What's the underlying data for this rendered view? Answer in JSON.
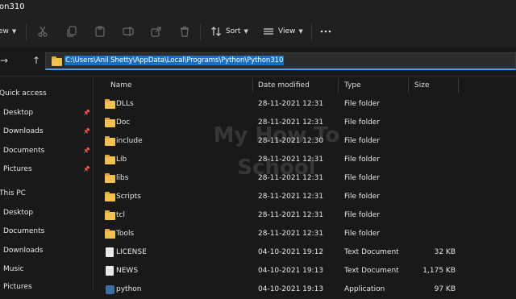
{
  "window": {
    "title": "on310"
  },
  "toolbar": {
    "view_partial": "ew",
    "sort": "Sort",
    "view": "View",
    "icons": [
      "cut-icon",
      "copy-icon",
      "paste-icon",
      "rename-icon",
      "share-icon",
      "delete-icon",
      "more-icon"
    ]
  },
  "address": {
    "back": "←",
    "forward": "→",
    "up": "↑",
    "path": "C:\\Users\\Anil Shetty\\AppData\\Local\\Programs\\Python\\Python310"
  },
  "sidebar": {
    "quick_access": "Quick access",
    "this_pc": "This PC",
    "quick_items": [
      {
        "label": "Desktop"
      },
      {
        "label": "Downloads"
      },
      {
        "label": "Documents"
      },
      {
        "label": "Pictures"
      }
    ],
    "pc_items": [
      {
        "label": "Desktop"
      },
      {
        "label": "Documents"
      },
      {
        "label": "Downloads"
      },
      {
        "label": "Music"
      },
      {
        "label": "Pictures"
      }
    ]
  },
  "columns": {
    "name": "Name",
    "date": "Date modified",
    "type": "Type",
    "size": "Size"
  },
  "files": [
    {
      "name": "DLLs",
      "date": "28-11-2021 12:31",
      "type": "File folder",
      "size": "",
      "icon": "folder"
    },
    {
      "name": "Doc",
      "date": "28-11-2021 12:31",
      "type": "File folder",
      "size": "",
      "icon": "folder"
    },
    {
      "name": "include",
      "date": "28-11-2021 12:30",
      "type": "File folder",
      "size": "",
      "icon": "folder"
    },
    {
      "name": "Lib",
      "date": "28-11-2021 12:31",
      "type": "File folder",
      "size": "",
      "icon": "folder"
    },
    {
      "name": "libs",
      "date": "28-11-2021 12:31",
      "type": "File folder",
      "size": "",
      "icon": "folder"
    },
    {
      "name": "Scripts",
      "date": "28-11-2021 12:31",
      "type": "File folder",
      "size": "",
      "icon": "folder"
    },
    {
      "name": "tcl",
      "date": "28-11-2021 12:31",
      "type": "File folder",
      "size": "",
      "icon": "folder"
    },
    {
      "name": "Tools",
      "date": "28-11-2021 12:31",
      "type": "File folder",
      "size": "",
      "icon": "folder"
    },
    {
      "name": "LICENSE",
      "date": "04-10-2021 19:12",
      "type": "Text Document",
      "size": "32 KB",
      "icon": "file"
    },
    {
      "name": "NEWS",
      "date": "04-10-2021 19:13",
      "type": "Text Document",
      "size": "1,175 KB",
      "icon": "file"
    },
    {
      "name": "python",
      "date": "04-10-2021 19:13",
      "type": "Application",
      "size": "97 KB",
      "icon": "app"
    }
  ],
  "watermark": {
    "line1": "My How To",
    "line2": "School"
  }
}
